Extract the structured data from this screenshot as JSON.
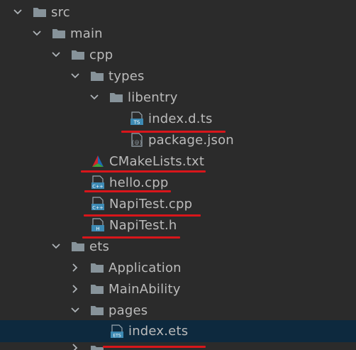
{
  "tree": {
    "src": "src",
    "main": "main",
    "cpp": "cpp",
    "types": "types",
    "libentry": "libentry",
    "index_d_ts": "index.d.ts",
    "package_json": "package.json",
    "cmakelists": "CMakeLists.txt",
    "hello_cpp": "hello.cpp",
    "napitest_cpp": "NapiTest.cpp",
    "napitest_h": "NapiTest.h",
    "ets": "ets",
    "application": "Application",
    "mainability": "MainAbility",
    "pages": "pages",
    "index_ets": "index.ets"
  },
  "icons": {
    "ts_badge": "TS",
    "cpp_badge": "C++",
    "h_badge": "H",
    "ets_badge": "ETS",
    "json_badge": "{@}"
  },
  "colors": {
    "background": "#2b2b2b",
    "selection": "#0d293e",
    "folder": "#87939a",
    "file_badge": "#3d8ab4",
    "annotation": "#d8161b"
  }
}
